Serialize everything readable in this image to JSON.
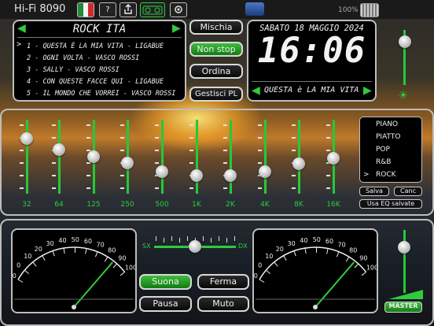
{
  "app_title": "Hi-Fi 8090",
  "toolbar": {
    "icons": [
      "italy-flag-icon",
      "help-icon",
      "share-icon",
      "radio-icon",
      "settings-icon"
    ],
    "help_label": "?",
    "battery_percent": "100%"
  },
  "playlist": {
    "title": "ROCK ITA",
    "tracks": [
      "1 - QUESTA È LA MIA VITA - LIGABUE",
      "2 - OGNI VOLTA - VASCO ROSSI",
      "3 - SALLY - VASCO ROSSI",
      "4 - CON QUESTE FACCE QUI - LIGABUE",
      "5 - IL MONDO CHE VORREI - VASCO ROSSI"
    ],
    "current_marker": ">"
  },
  "buttons": {
    "shuffle": "Mischia",
    "nonstop": "Non stop",
    "sort": "Ordina",
    "manage": "Gestisci PL"
  },
  "clock": {
    "date": "SABATO 18 MAGGIO 2024",
    "time": "16:06",
    "now_playing": "QUESTA è LA MIA VITA -"
  },
  "equalizer": {
    "bands": [
      "32",
      "64",
      "125",
      "250",
      "500",
      "1K",
      "2K",
      "4K",
      "8K",
      "16K"
    ],
    "levels": [
      0.75,
      0.6,
      0.5,
      0.42,
      0.3,
      0.25,
      0.25,
      0.3,
      0.4,
      0.48
    ],
    "presets": [
      "PIANO",
      "PIATTO",
      "POP",
      "R&B",
      "ROCK"
    ],
    "selected_preset": "ROCK",
    "save_label": "Salva",
    "cancel_label": "Canc",
    "use_saved_label": "Usa EQ salvate"
  },
  "balance": {
    "left_label": "SX",
    "right_label": "DX",
    "value": 0.5
  },
  "transport": {
    "play": "Suona",
    "stop": "Ferma",
    "pause": "Pausa",
    "mute": "Muto"
  },
  "vu_scale": [
    "-10",
    "0",
    "10",
    "20",
    "30",
    "40",
    "50",
    "60",
    "70",
    "80",
    "90",
    "100"
  ],
  "master": {
    "label": "MASTER",
    "level": 0.72
  },
  "brightness": {
    "level": 0.78
  },
  "colors": {
    "accent_green": "#2ecc3c",
    "panel_border": "#bdbdbd"
  }
}
